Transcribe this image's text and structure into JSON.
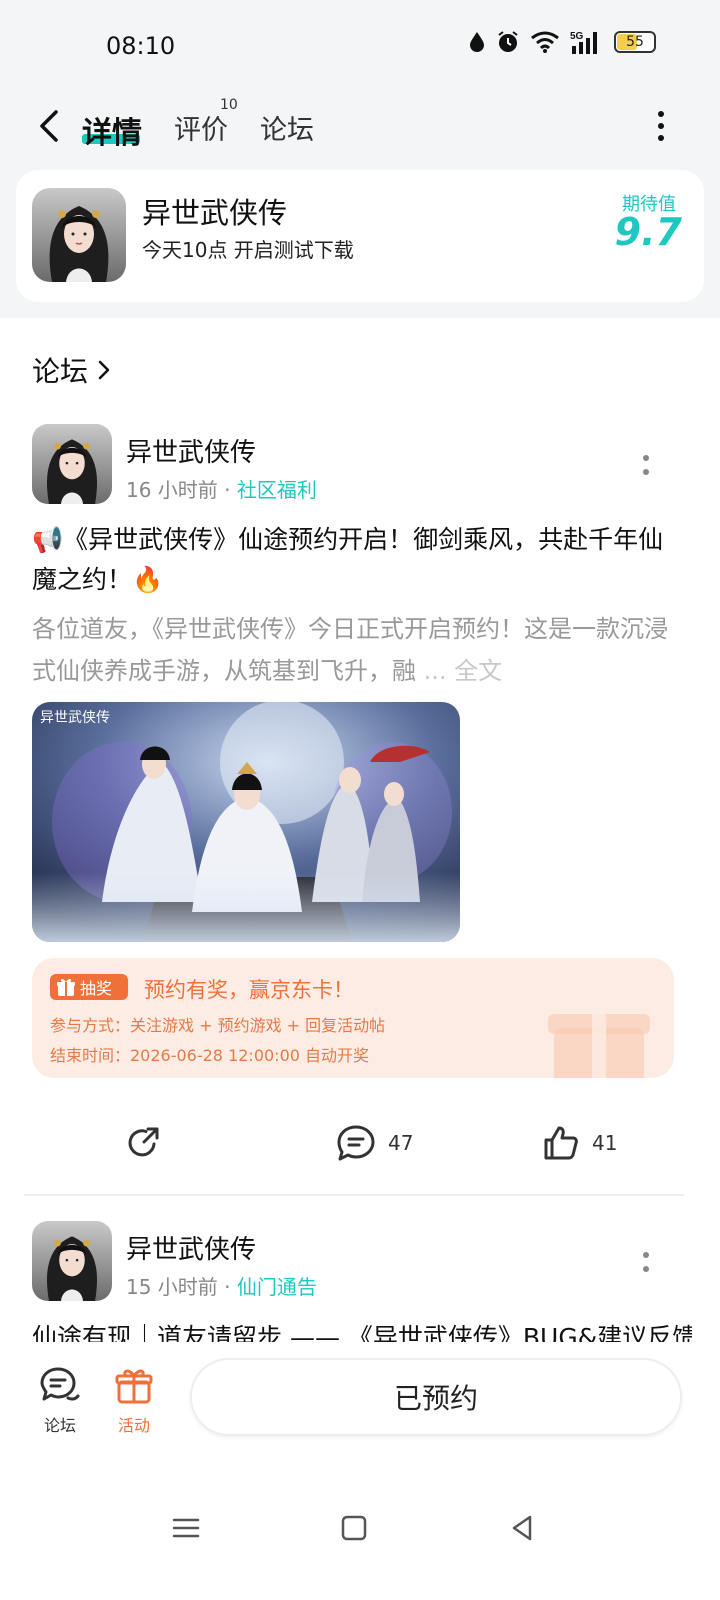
{
  "status_bar": {
    "time": "08:10",
    "battery": "55",
    "battery_level": 0.55,
    "icons": [
      "water-drop-icon",
      "alarm-icon",
      "wifi-icon",
      "5g-signal-icon",
      "battery-icon"
    ]
  },
  "header": {
    "tabs": [
      {
        "label": "详情",
        "active": true
      },
      {
        "label": "评价",
        "active": false
      },
      {
        "label": "论坛",
        "active": false
      }
    ],
    "review_badge": "10"
  },
  "game": {
    "title": "异世武侠传",
    "subtitle": "今天10点 开启测试下载",
    "rating_label": "期待值",
    "rating_value": "9.7"
  },
  "forum": {
    "section_title": "论坛"
  },
  "posts": [
    {
      "author": "异世武侠传",
      "time": "16 小时前",
      "separator": "·",
      "tag": "社区福利",
      "title": "📢《异世武侠传》仙途预约开启！御剑乘风，共赴千年仙魔之约！🔥",
      "body": "各位道友，《异世武侠传》今日正式开启预约！这是一款沉浸式仙侠养成手游，从筑基到飞升，融",
      "body_more": "... 全文",
      "image_title": "异世武侠传",
      "lottery": {
        "badge": "抽奖",
        "title": "预约有奖，赢京东卡！",
        "method": "参与方式：关注游戏 + 预约游戏 + 回复活动帖",
        "end_time": "结束时间：2026-06-28 12:00:00 自动开奖"
      },
      "comments": "47",
      "likes": "41"
    },
    {
      "author": "异世武侠传",
      "time": "15 小时前",
      "separator": "·",
      "tag": "仙门通告",
      "title": "仙途有现｜道友请留步 —— 《异世武侠传》BUG&建议反馈"
    }
  ],
  "bottom_bar": {
    "forum_label": "论坛",
    "activity_label": "活动",
    "reserve_label": "已预约"
  },
  "colors": {
    "accent": "#1ec8c0",
    "orange": "#f07039",
    "lottery_bg": "#fdece3"
  }
}
